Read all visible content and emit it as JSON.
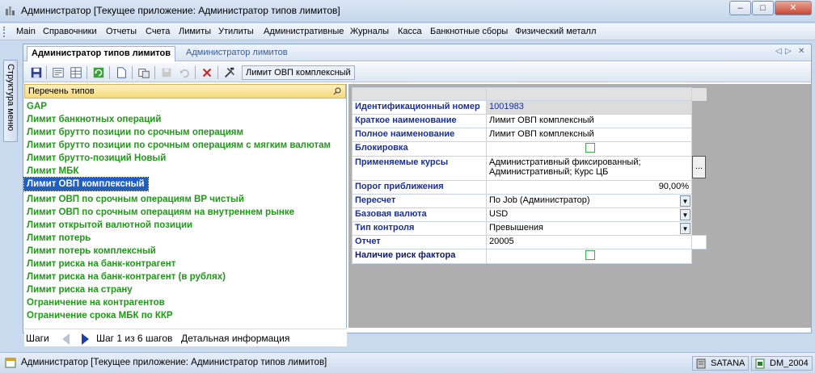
{
  "window": {
    "title": "Администратор [Текущее приложение: Администратор типов лимитов]",
    "minimize": "–",
    "maximize": "□",
    "close": "✕"
  },
  "menu": [
    "Main",
    "Справочники",
    "Отчеты",
    "Счета",
    "Лимиты",
    "Утилиты",
    "Административные",
    "Журналы",
    "Касса",
    "Банкнотные сборы",
    "Физический металл"
  ],
  "sidetab": {
    "label": "Структура меню"
  },
  "tabs": [
    {
      "label": "Администратор типов лимитов",
      "active": true
    },
    {
      "label": "Администратор лимитов",
      "active": false
    }
  ],
  "tab_nav": {
    "left": "◁",
    "right": "▷",
    "close": "✕"
  },
  "toolbar": {
    "icons": [
      "save-icon",
      "properties-icon",
      "grid-icon",
      "refresh-icon",
      "new-document-icon",
      "copy-icon",
      "save-disabled-icon",
      "undo-disabled-icon",
      "delete-icon",
      "tools-icon"
    ],
    "current_label": "Лимит ОВП комплексный"
  },
  "left_panel": {
    "header": "Перечень типов",
    "items": [
      "GAP",
      "Лимит банкнотных операций",
      "Лимит брутто позиции по срочным операциям",
      "Лимит брутто позиции по срочным операциям с мягким валютам",
      "Лимит брутто-позиций Новый",
      "Лимит МБК",
      "Лимит ОВП комплексный",
      "Лимит ОВП по срочным операциям ВР чистый",
      "Лимит ОВП по срочным операциям на внутреннем рынке",
      "Лимит открытой валютной позиции",
      "Лимит потерь",
      "Лимит потерь комплексный",
      "Лимит риска на банк-контрагент",
      "Лимит риска на банк-контрагент (в рублях)",
      "Лимит риска на страну",
      "Ограничение на контрагентов",
      "Ограничение срока МБК по ККР"
    ],
    "selected_index": 6
  },
  "footer": {
    "steps_label": "Шаги",
    "step_info": "Шаг 1 из 6 шагов",
    "detail_label": "Детальная информация"
  },
  "properties": {
    "id_label": "Идентификационный номер",
    "id_value": "1001983",
    "short_name_label": "Краткое наименование",
    "short_name_value": "Лимит ОВП комплексный",
    "full_name_label": "Полное наименование",
    "full_name_value": "Лимит ОВП комплексный",
    "block_label": "Блокировка",
    "rates_label": "Применяемые курсы",
    "rates_value_line1": "Административный фиксированный;",
    "rates_value_line2": "Административный; Курс ЦБ",
    "rates_button": "...",
    "threshold_label": "Порог приближения",
    "threshold_value": "90,00%",
    "recalc_label": "Пересчет",
    "recalc_value": "По Job (Администратор)",
    "currency_label": "Базовая валюта",
    "currency_value": "USD",
    "control_label": "Тип контроля",
    "control_value": "Превышения",
    "report_label": "Отчет",
    "report_value": "20005",
    "risk_label": "Наличие риск фактора"
  },
  "statusbar": {
    "text": "Администратор [Текущее приложение: Администратор типов лимитов]",
    "server": "SATANA",
    "database": "DM_2004"
  },
  "colors": {
    "list_green": "#1e9b16",
    "selection_blue": "#1f5fbf",
    "label_navy": "#1a2f96"
  }
}
